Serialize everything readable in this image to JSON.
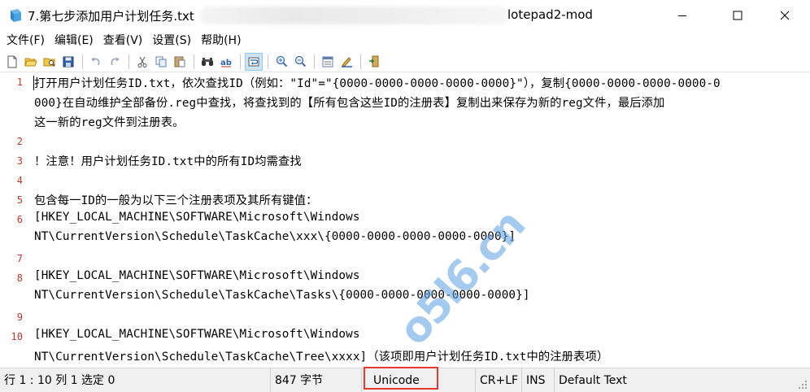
{
  "window": {
    "title": "7.第七步添加用户计划任务.txt",
    "title_suffix": "lotepad2-mod"
  },
  "menu": [
    "文件(F)",
    "编辑(E)",
    "查看(V)",
    "设置(S)",
    "帮助(H)"
  ],
  "toolbar": {
    "buttons": [
      "new-file",
      "open-file",
      "browse",
      "save",
      "undo",
      "redo",
      "cut",
      "copy",
      "paste",
      "find",
      "replace",
      "word-wrap",
      "zoom-in",
      "zoom-out",
      "scheme",
      "customize-scheme",
      "exit"
    ]
  },
  "editor": {
    "line_numbers": [
      "1",
      "2",
      "3",
      "4",
      "5",
      "6",
      "7",
      "8",
      "9",
      "10"
    ],
    "rows": [
      "打开用户计划任务ID.txt，依次查找ID（例如：\"Id\"=\"{0000-0000-0000-0000-0000}\"），复制{0000-0000-0000-0000-0",
      "000}在自动维护全部备份.reg中查找，将查找到的【所有包含这些ID的注册表】复制出来保存为新的reg文件，最后添加",
      "这一新的reg文件到注册表。",
      "",
      "！注意！用户计划任务ID.txt中的所有ID均需查找",
      "",
      "包含每一ID的一般为以下三个注册表项及其所有键值：",
      "[HKEY_LOCAL_MACHINE\\SOFTWARE\\Microsoft\\Windows",
      "NT\\CurrentVersion\\Schedule\\TaskCache\\xxx\\{0000-0000-0000-0000-0000}]",
      "",
      "[HKEY_LOCAL_MACHINE\\SOFTWARE\\Microsoft\\Windows",
      "NT\\CurrentVersion\\Schedule\\TaskCache\\Tasks\\{0000-0000-0000-0000-0000}]",
      "",
      "[HKEY_LOCAL_MACHINE\\SOFTWARE\\Microsoft\\Windows",
      "NT\\CurrentVersion\\Schedule\\TaskCache\\Tree\\xxxx]（该项即用户计划任务ID.txt中的注册表项）"
    ],
    "watermark": "o5l6.cn"
  },
  "status": {
    "position": "行 1 : 10   列 1   选定 0",
    "size": "847 字节",
    "encoding": "Unicode",
    "eol": "CR+LF",
    "mode": "INS",
    "scheme": "Default Text"
  },
  "colors": {
    "line_number": "#c0392b",
    "highlight_box": "#e53935",
    "watermark": "#5aa0e1"
  }
}
